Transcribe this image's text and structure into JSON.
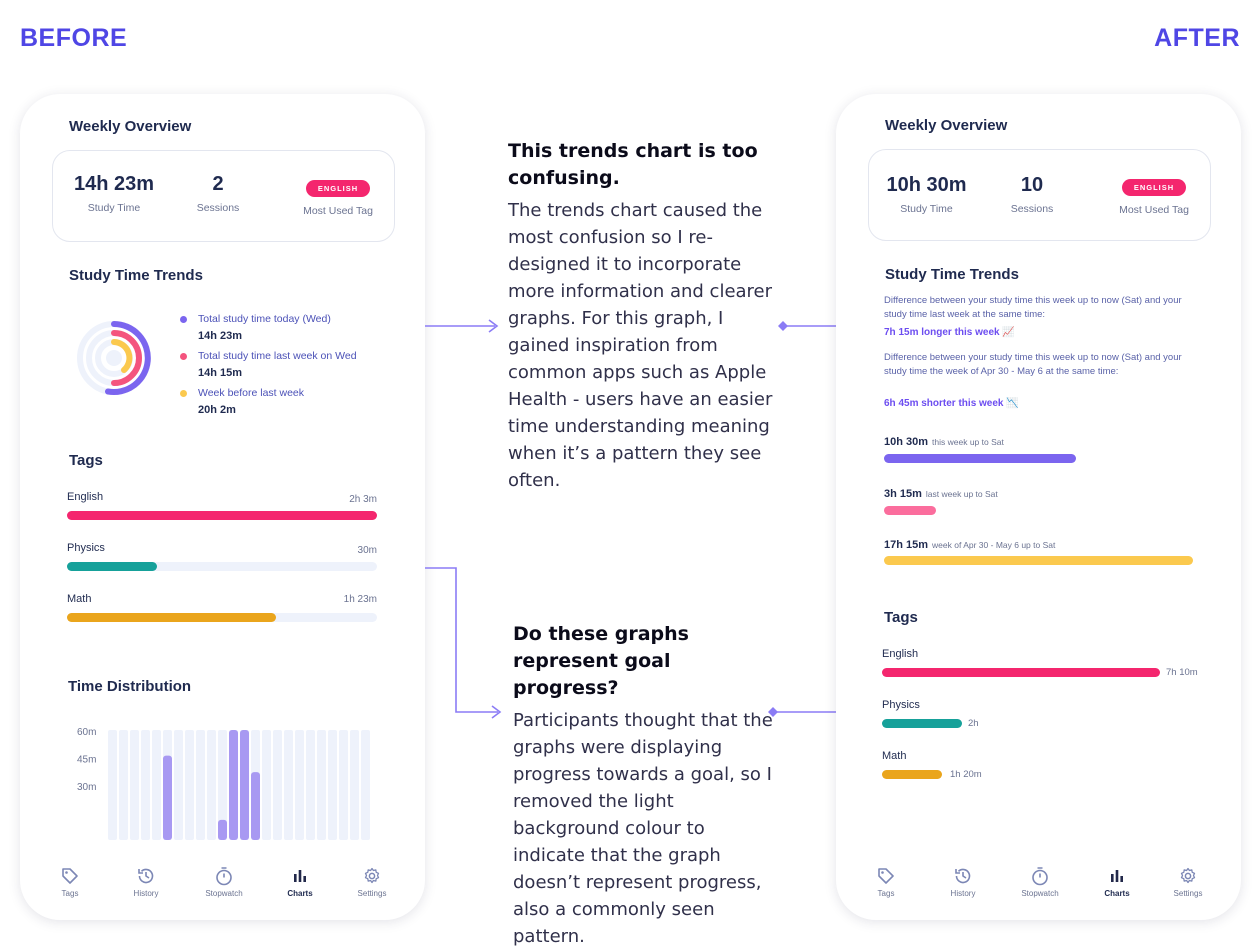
{
  "headings": {
    "before": "BEFORE",
    "after": "AFTER"
  },
  "colors": {
    "accent": "#4f46e5",
    "pink": "#f4266e",
    "teal": "#16a19a",
    "amber": "#eaa51c",
    "purple": "#7b65ef",
    "lightPink": "#fb6d9d",
    "yellow": "#fbc94e"
  },
  "before": {
    "overview_title": "Weekly Overview",
    "stats": [
      {
        "value": "14h 23m",
        "label": "Study Time"
      },
      {
        "value": "2",
        "label": "Sessions"
      },
      {
        "value": "ENGLISH",
        "label": "Most Used Tag"
      }
    ],
    "trends_title": "Study Time Trends",
    "legend": [
      {
        "desc": "Total study time today (Wed)",
        "value": "14h 23m",
        "color": "#7b65ef"
      },
      {
        "desc": "Total study time last week on Wed",
        "value": "14h 15m",
        "color": "#f4547e"
      },
      {
        "desc": "Week before last week",
        "value": "20h 2m",
        "color": "#fbc94e"
      }
    ],
    "tags_title": "Tags",
    "tags": [
      {
        "name": "English",
        "duration": "2h 3m",
        "fraction": 1.0,
        "color": "#f4266e"
      },
      {
        "name": "Physics",
        "duration": "30m",
        "fraction": 0.29,
        "color": "#16a19a"
      },
      {
        "name": "Math",
        "duration": "1h 23m",
        "fraction": 0.67,
        "color": "#eaa51c"
      }
    ],
    "distribution_title": "Time Distribution"
  },
  "chart_data": {
    "type": "bar",
    "title": "Time Distribution",
    "ytick_labels": [
      "60m",
      "45m",
      "30m"
    ],
    "ylim": [
      0,
      60
    ],
    "categories_count": 24,
    "values": [
      0,
      0,
      0,
      0,
      0,
      46,
      0,
      0,
      0,
      0,
      11,
      60,
      60,
      37,
      0,
      0,
      0,
      0,
      0,
      0,
      0,
      0,
      0,
      0
    ]
  },
  "nav": [
    {
      "label": "Tags",
      "icon": "tag-icon",
      "active": false
    },
    {
      "label": "History",
      "icon": "history-icon",
      "active": false
    },
    {
      "label": "Stopwatch",
      "icon": "stopwatch-icon",
      "active": false
    },
    {
      "label": "Charts",
      "icon": "chart-icon",
      "active": true
    },
    {
      "label": "Settings",
      "icon": "gear-icon",
      "active": false
    }
  ],
  "annotations": [
    {
      "title": "This trends chart is too confusing.",
      "body": "The trends chart caused the most confusion so I re-designed it to incorporate more information and clearer graphs. For this graph, I gained inspiration from common apps such as Apple Health - users have an easier time understanding meaning when it’s a pattern they see often."
    },
    {
      "title": "Do these graphs represent goal progress?",
      "body": "Participants thought that the graphs were displaying progress towards a goal, so I removed the light background colour to indicate that the graph doesn’t represent progress, also a commonly seen pattern."
    }
  ],
  "after": {
    "overview_title": "Weekly Overview",
    "stats": [
      {
        "value": "10h 30m",
        "label": "Study Time"
      },
      {
        "value": "10",
        "label": "Sessions"
      },
      {
        "value": "ENGLISH",
        "label": "Most Used Tag"
      }
    ],
    "trends_title": "Study Time Trends",
    "diff1_text": "Difference between your study time this week up to now (Sat) and your study time last week at the same time:",
    "diff1_value": "7h 15m longer this week 📈",
    "diff2_text": "Difference between your study time this week up to now (Sat) and your study time the week of Apr 30 - May 6 at the same time:",
    "diff2_value": "6h 45m shorter this week 📉",
    "bars": [
      {
        "value": "10h 30m",
        "desc": "this week up to Sat",
        "fraction": 0.62,
        "color": "#7b65ef"
      },
      {
        "value": "3h 15m",
        "desc": "last week up to Sat",
        "fraction": 0.17,
        "color": "#fb6d9d"
      },
      {
        "value": "17h 15m",
        "desc": "week of Apr 30 - May 6 up to Sat",
        "fraction": 1.0,
        "color": "#fbc94e"
      }
    ],
    "tags_title": "Tags",
    "tags": [
      {
        "name": "English",
        "duration": "7h 10m",
        "fraction": 1.0,
        "color": "#f4266e"
      },
      {
        "name": "Physics",
        "duration": "2h",
        "fraction": 0.29,
        "color": "#16a19a"
      },
      {
        "name": "Math",
        "duration": "1h 20m",
        "fraction": 0.22,
        "color": "#eaa51c"
      }
    ]
  }
}
